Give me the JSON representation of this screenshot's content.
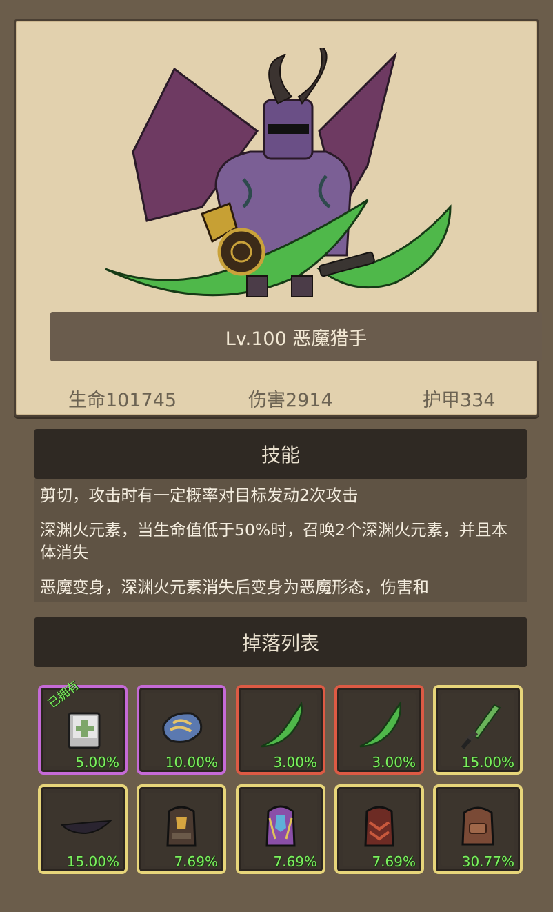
{
  "boss": {
    "name_line": "Lv.100 恶魔猎手",
    "stats": [
      "生命101745",
      "伤害2914",
      "护甲334"
    ]
  },
  "skills": {
    "header": "技能",
    "lines": [
      "剪切，攻击时有一定概率对目标发动2次攻击",
      "深渊火元素，当生命值低于50%时，召唤2个深渊火元素，并且本体消失",
      "恶魔变身，深渊火元素消失后变身为恶魔形态，伤害和"
    ]
  },
  "drops": {
    "header": "掉落列表",
    "owned_label": "已拥有",
    "items": [
      {
        "icon": "skill-book-icon",
        "rarity": "purple",
        "chance": "5.00%",
        "owned": true
      },
      {
        "icon": "rune-stone-icon",
        "rarity": "purple",
        "chance": "10.00%",
        "owned": false
      },
      {
        "icon": "warglaive-icon",
        "rarity": "red",
        "chance": "3.00%",
        "owned": false
      },
      {
        "icon": "warglaive-icon",
        "rarity": "red",
        "chance": "3.00%",
        "owned": false
      },
      {
        "icon": "green-sword-icon",
        "rarity": "gold",
        "chance": "15.00%",
        "owned": false
      },
      {
        "icon": "dark-blade-icon",
        "rarity": "gold",
        "chance": "15.00%",
        "owned": false
      },
      {
        "icon": "bronze-armor-icon",
        "rarity": "gold",
        "chance": "7.69%",
        "owned": false
      },
      {
        "icon": "purple-armor-icon",
        "rarity": "gold",
        "chance": "7.69%",
        "owned": false
      },
      {
        "icon": "red-armor-icon",
        "rarity": "gold",
        "chance": "7.69%",
        "owned": false
      },
      {
        "icon": "leather-armor-icon",
        "rarity": "gold",
        "chance": "30.77%",
        "owned": false
      }
    ]
  },
  "colors": {
    "background": "#6b5d4b",
    "card": "#e2d1ae",
    "rarity_purple": "#c56ad6",
    "rarity_red": "#dd5a44",
    "rarity_gold": "#e7d57a",
    "chance_green": "#7bf05e"
  }
}
